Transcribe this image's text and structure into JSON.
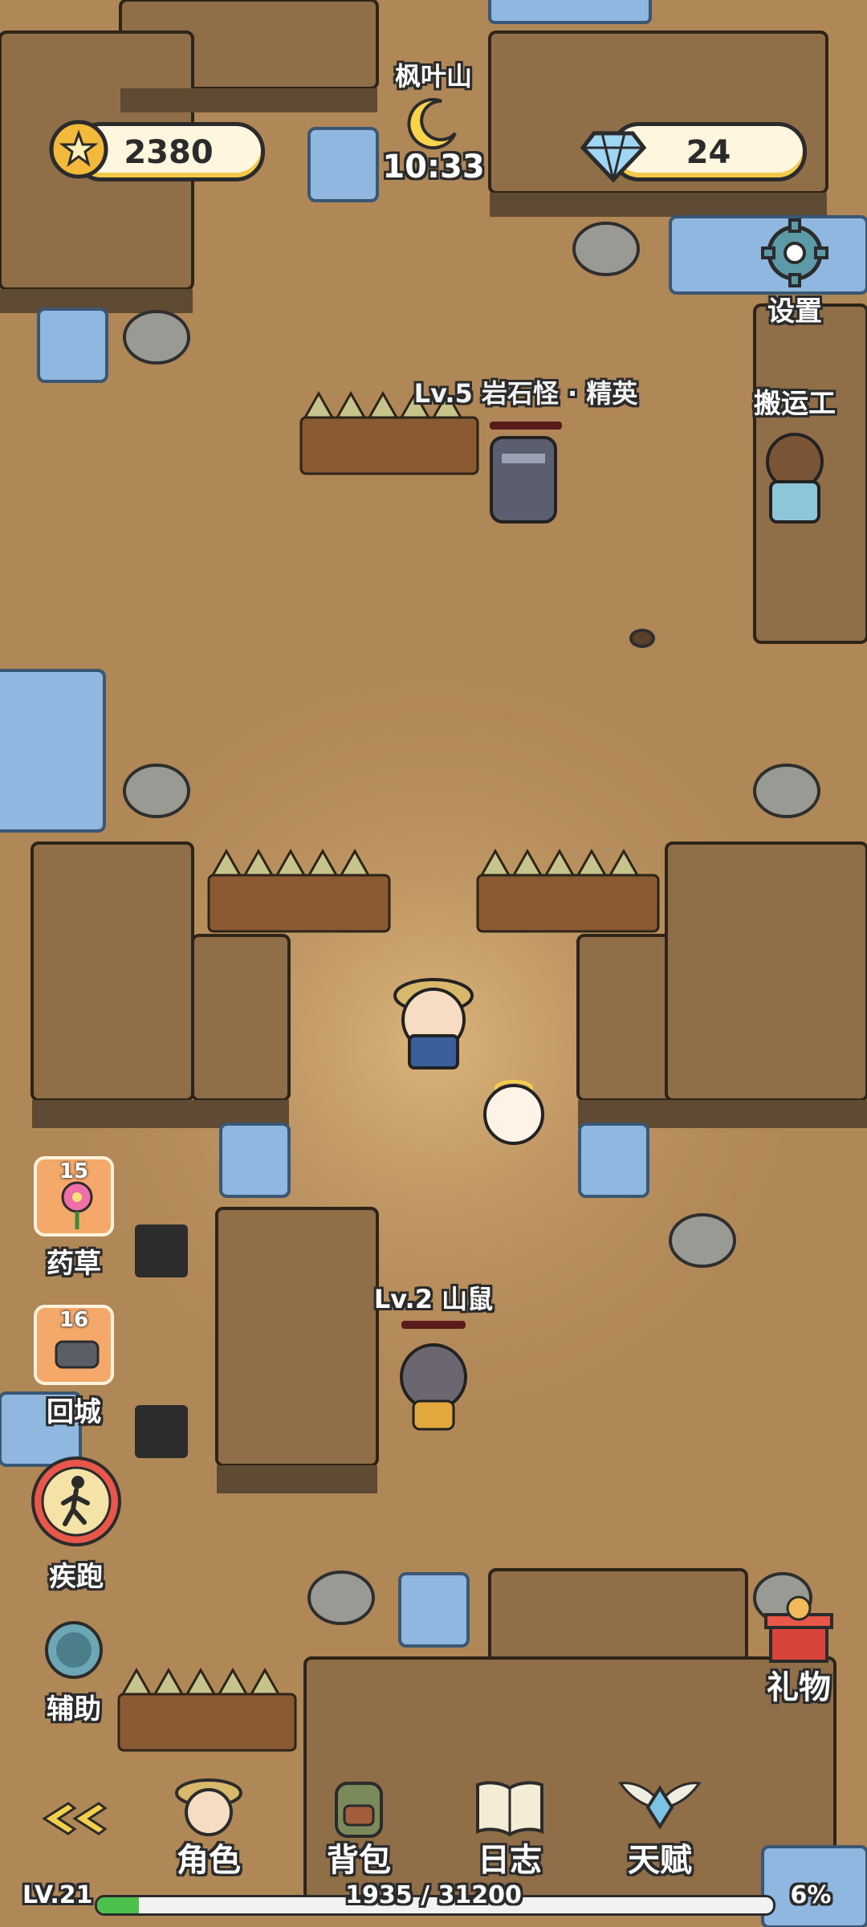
{
  "hud": {
    "location": "枫叶山",
    "time": "10:33",
    "coins": "2380",
    "gems": "24",
    "settings_label": "设置",
    "gift_label": "礼物"
  },
  "npcs": {
    "elite": "Lv.5 岩石怪 · 精英",
    "porter": "搬运工",
    "rat": "Lv.2 山鼠"
  },
  "side_buttons": {
    "herb": {
      "count": "15",
      "label": "药草"
    },
    "return": {
      "count": "16",
      "label": "回城"
    },
    "sprint": {
      "label": "疾跑"
    },
    "assist": {
      "label": "辅助"
    }
  },
  "nav": {
    "character": "角色",
    "backpack": "背包",
    "journal": "日志",
    "talent": "天赋"
  },
  "xp": {
    "level": "LV.21",
    "progress_text": "1935 / 31200",
    "percent_text": "6%",
    "fraction": 0.062
  },
  "colors": {
    "ground": "#b88f5c",
    "cliff": "#8a6a45",
    "water": "#8fb7e0",
    "xp_fill": "#4cc04c"
  }
}
